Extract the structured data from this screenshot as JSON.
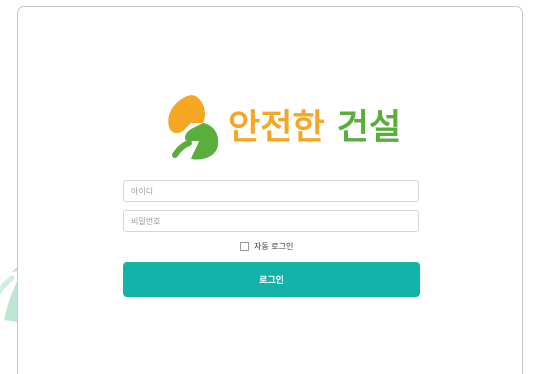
{
  "brand": {
    "word1": "안전한",
    "word2": "건설",
    "colors": {
      "orange": "#f5a623",
      "green": "#5aae3c"
    },
    "icon": "bolt-logo-icon"
  },
  "form": {
    "id_placeholder": "아이디",
    "pw_placeholder": "비밀번호",
    "auto_login_label": "자동 로그인",
    "auto_login_checked": false,
    "submit_label": "로그인"
  },
  "colors": {
    "accent": "#13b3a9",
    "card_border": "#c8c8c8",
    "decoration": "#bfe6d4"
  }
}
